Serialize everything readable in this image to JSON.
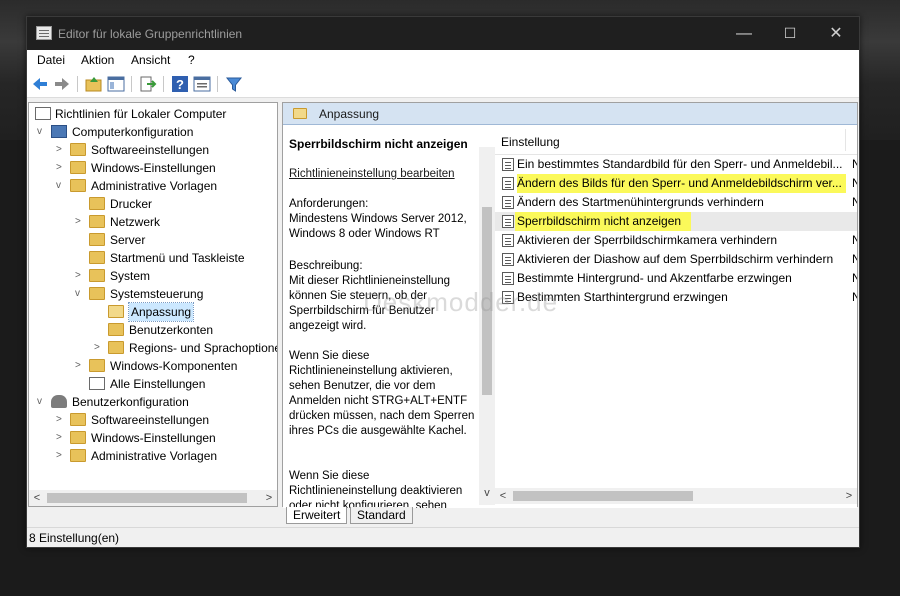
{
  "window": {
    "title": "Editor für lokale Gruppenrichtlinien",
    "buttons": [
      "—",
      "☐",
      "✕"
    ]
  },
  "menu": [
    "Datei",
    "Aktion",
    "Ansicht",
    "?"
  ],
  "toolbar": {
    "icons": [
      "back-arrow-icon",
      "forward-arrow-icon",
      "up-folder-icon",
      "show-hide-tree-icon",
      "export-list-icon",
      "help-icon",
      "properties-icon",
      "filter-icon"
    ]
  },
  "tree": [
    {
      "label": "Richtlinien für Lokaler Computer",
      "icon": "policy-doc-icon",
      "expander": ""
    },
    {
      "label": "Computerkonfiguration",
      "icon": "computer-icon",
      "expander": "v"
    },
    {
      "label": "Softwareeinstellungen",
      "icon": "folder-icon",
      "expander": ">"
    },
    {
      "label": "Windows-Einstellungen",
      "icon": "folder-icon",
      "expander": ">"
    },
    {
      "label": "Administrative Vorlagen",
      "icon": "folder-icon",
      "expander": "v"
    },
    {
      "label": "Drucker",
      "icon": "folder-icon",
      "expander": ""
    },
    {
      "label": "Netzwerk",
      "icon": "folder-icon",
      "expander": ">"
    },
    {
      "label": "Server",
      "icon": "folder-icon",
      "expander": ""
    },
    {
      "label": "Startmenü und Taskleiste",
      "icon": "folder-icon",
      "expander": ""
    },
    {
      "label": "System",
      "icon": "folder-icon",
      "expander": ">"
    },
    {
      "label": "Systemsteuerung",
      "icon": "folder-icon",
      "expander": "v"
    },
    {
      "label": "Anpassung",
      "icon": "folder-open-icon",
      "expander": "",
      "selected": true
    },
    {
      "label": "Benutzerkonten",
      "icon": "folder-icon",
      "expander": ""
    },
    {
      "label": "Regions- und Sprachoptione",
      "icon": "folder-icon",
      "expander": ">"
    },
    {
      "label": "Windows-Komponenten",
      "icon": "folder-icon",
      "expander": ">"
    },
    {
      "label": "Alle Einstellungen",
      "icon": "all-settings-icon",
      "expander": ""
    },
    {
      "label": "Benutzerkonfiguration",
      "icon": "user-icon",
      "expander": "v"
    },
    {
      "label": "Softwareeinstellungen",
      "icon": "folder-icon",
      "expander": ">"
    },
    {
      "label": "Windows-Einstellungen",
      "icon": "folder-icon",
      "expander": ">"
    },
    {
      "label": "Administrative Vorlagen",
      "icon": "folder-icon",
      "expander": ">"
    }
  ],
  "category": {
    "title": "Anpassung"
  },
  "description": {
    "title": "Sperrbildschirm nicht anzeigen",
    "edit_link": "Richtlinieneinstellung bearbeiten",
    "requirements": "Anforderungen:\nMindestens Windows Server 2012, Windows 8 oder Windows RT",
    "description": "Beschreibung:\nMit dieser Richtlinieneinstellung können Sie steuern, ob der Sperrbildschirm für Benutzer angezeigt wird.",
    "p_enable": "Wenn Sie diese Richtlinieneinstellung aktivieren, sehen Benutzer, die vor dem Anmelden nicht STRG+ALT+ENTF drücken müssen, nach dem Sperren ihres PCs die ausgewählte Kachel.",
    "p_disable": "Wenn Sie diese Richtlinieneinstellung deaktivieren oder nicht konfigurieren, sehen"
  },
  "list": {
    "column_header": "Einstellung",
    "rows": [
      {
        "label": "Ein bestimmtes Standardbild für den Sperr- und Anmeldebil...",
        "state": "N",
        "highlight": false
      },
      {
        "label": "Ändern des Bilds für den Sperr- und Anmeldebildschirm ver...",
        "state": "N",
        "highlight": true
      },
      {
        "label": "Ändern des Startmenühintergrunds verhindern",
        "state": "N",
        "highlight": false
      },
      {
        "label": "Sperrbildschirm nicht anzeigen",
        "state": "",
        "highlight": true
      },
      {
        "label": "Aktivieren der Sperrbildschirmkamera verhindern",
        "state": "N",
        "highlight": false
      },
      {
        "label": "Aktivieren der Diashow auf dem Sperrbildschirm verhindern",
        "state": "N",
        "highlight": false
      },
      {
        "label": "Bestimmte Hintergrund- und Akzentfarbe erzwingen",
        "state": "N",
        "highlight": false
      },
      {
        "label": "Bestimmten Starthintergrund erzwingen",
        "state": "N",
        "highlight": false
      }
    ]
  },
  "tabs": [
    "Erweitert",
    "Standard"
  ],
  "status": "8 Einstellung(en)",
  "watermark": "Deskmodder.de",
  "colors": {
    "highlight": "#fbf95a",
    "selection": "#cce8ff",
    "header": "#d5e3f2"
  }
}
